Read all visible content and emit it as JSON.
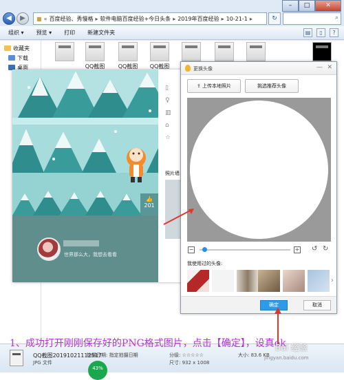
{
  "explorer": {
    "breadcrumb": [
      "百度经验、秀慢格",
      "软件电脑百度经验+今日头条",
      "2019年百度经验",
      "10-21-1"
    ],
    "toolbar": {
      "organize": "组织 ▾",
      "preview": "预览 ▾",
      "print": "打印",
      "new_folder": "新建文件夹"
    },
    "sidebar": [
      {
        "label": "收藏夹",
        "color": "#f2c14e"
      },
      {
        "label": "下载",
        "color": "#5a8fd6"
      },
      {
        "label": "桌面",
        "color": "#3b6fb6"
      }
    ],
    "thumbnails": [
      {
        "label": ""
      },
      {
        "label": "QQ截图"
      },
      {
        "label": "QQ截图"
      },
      {
        "label": "QQ截图"
      },
      {
        "label": ""
      },
      {
        "label": ""
      },
      {
        "label": ""
      },
      {
        "label": ""
      }
    ],
    "details": {
      "name": "QQ截图20191021112517",
      "type": "JPG 文件",
      "date": "拍摄日期: 指定拍摄日期",
      "rating": "分级: ☆☆☆☆☆",
      "dimensions": "尺寸: 932 x 1008",
      "size_label": "大小: 83.6 KB",
      "progress_percent": "43%"
    }
  },
  "profile": {
    "cover_label": "",
    "like_count": "201",
    "signature": "世界那么大，我想去看看",
    "album_label": "照片墙"
  },
  "dialog": {
    "title": "更换头像",
    "upload_label": "上传本地照片",
    "choose_label": "挑选推荐头像",
    "used_label": "我使用过的头像:",
    "ok_label": "确定",
    "cancel_label": "取消",
    "zoom_level": 0.03
  },
  "caption": "1、成功打开刚刚保存好的PNG格式图片，点击【确定】，设真ok",
  "watermark": "Bai 经验",
  "watermark_url": "jingyan.baidu.com",
  "colors": {
    "accent_blue": "#2d9be8",
    "caption": "#b533d9",
    "cover_sky": "#a6dcdc",
    "panel_teal": "#5f8e8d",
    "arrow_red": "#e0362c"
  }
}
